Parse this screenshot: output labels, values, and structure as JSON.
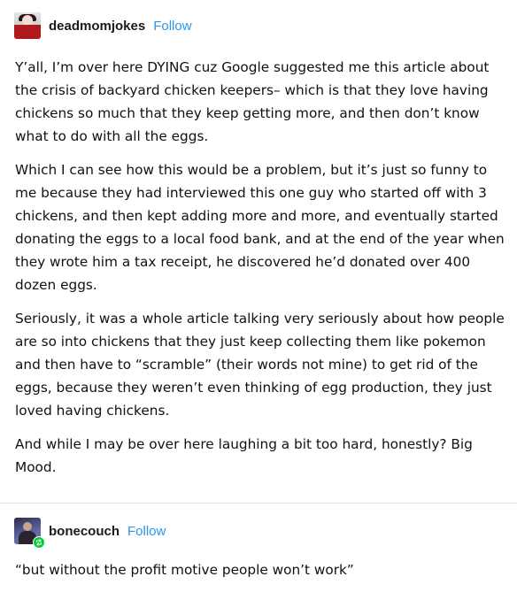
{
  "posts": [
    {
      "username": "deadmomjokes",
      "follow_label": "Follow",
      "paragraphs": [
        "Y’all, I’m over here DYING cuz Google suggested me this article about the crisis of backyard chicken keepers– which is that they love having chickens so much that they keep getting more, and then don’t know what to do with all the eggs.",
        "Which I can see how this would be a problem, but it’s just so funny to me because they had interviewed this one guy who started off with 3 chickens, and then kept adding more and more, and eventually started donating the eggs to a local food bank, and at the end of the year when they wrote him a tax receipt, he discovered he’d donated over 400 dozen eggs.",
        "Seriously, it was a whole article talking very seriously about how people are so into chickens that they just keep collecting them like pokemon and then have to “scramble” (their words not mine) to get rid of the eggs, because they weren’t even thinking of egg production, they just loved having chickens.",
        "And while I may be over here laughing a bit too hard, honestly? Big Mood."
      ]
    },
    {
      "username": "bonecouch",
      "follow_label": "Follow",
      "paragraphs": [
        "“but without the profit motive people won’t work”"
      ]
    }
  ],
  "colors": {
    "follow_link": "#2e95e8",
    "reblog_badge": "#00cf35",
    "divider": "#e2e2e2"
  },
  "icons": {
    "reblog_badge": "reblog-icon"
  }
}
